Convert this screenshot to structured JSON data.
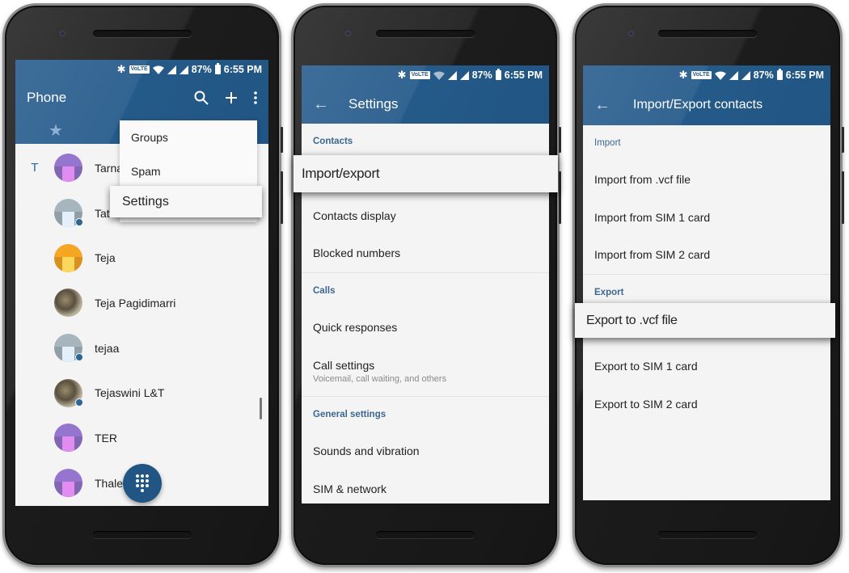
{
  "status_bar": {
    "volte_label": "VoLTE",
    "battery": "87%",
    "time": "6:55 PM"
  },
  "phone1": {
    "title": "Phone",
    "actions": {
      "search": "search-icon",
      "add": "plus-icon",
      "more": "more-vert-icon"
    },
    "menu": {
      "items": [
        "Groups",
        "Spam",
        "Settings"
      ],
      "highlighted": "Settings"
    },
    "section_letter": "T",
    "contacts": [
      {
        "name": "Tarna",
        "avatar": "placeholder",
        "color": "#9575cd",
        "fold": "#e08cf0",
        "badge": false
      },
      {
        "name": "Tato",
        "avatar": "placeholder",
        "color": "#a7b5bf",
        "fold": "#e3f0fb",
        "badge": true
      },
      {
        "name": "Teja",
        "avatar": "placeholder",
        "color": "#f5a623",
        "fold": "#fbd75b",
        "badge": false
      },
      {
        "name": "Teja Pagidimarri",
        "avatar": "photo",
        "badge": false
      },
      {
        "name": "tejaa",
        "avatar": "placeholder",
        "color": "#a7b5bf",
        "fold": "#e3f0fb",
        "badge": true
      },
      {
        "name": "Tejaswini L&T",
        "avatar": "photo",
        "badge": true
      },
      {
        "name": "TER",
        "avatar": "placeholder",
        "color": "#9575cd",
        "fold": "#e08cf0",
        "badge": false
      },
      {
        "name": "Thale",
        "avatar": "placeholder",
        "color": "#9575cd",
        "fold": "#e08cf0",
        "badge": false
      }
    ],
    "fab_icon": "dialpad-icon"
  },
  "phone2": {
    "title": "Settings",
    "sections": [
      {
        "header": "Contacts",
        "items": [
          {
            "label": "Import/export"
          },
          {
            "label": "Contacts display"
          },
          {
            "label": "Blocked numbers"
          }
        ]
      },
      {
        "header": "Calls",
        "items": [
          {
            "label": "Quick responses"
          },
          {
            "label": "Call settings",
            "sub": "Voicemail, call waiting, and others"
          }
        ]
      },
      {
        "header": "General settings",
        "items": [
          {
            "label": "Sounds and vibration"
          },
          {
            "label": "SIM & network"
          }
        ]
      }
    ],
    "highlighted": "Import/export"
  },
  "phone3": {
    "title": "Import/Export contacts",
    "sections": [
      {
        "header": "Import",
        "items": [
          "Import from .vcf file",
          "Import from SIM 1 card",
          "Import from SIM 2 card"
        ]
      },
      {
        "header": "Export",
        "items": [
          "Export to .vcf file",
          "Export to SIM 1 card",
          "Export to SIM 2 card"
        ]
      }
    ],
    "highlighted": "Export to .vcf file"
  },
  "colors": {
    "appbar": "#215583",
    "accent": "#3c6791",
    "background": "#f4f4f4"
  }
}
